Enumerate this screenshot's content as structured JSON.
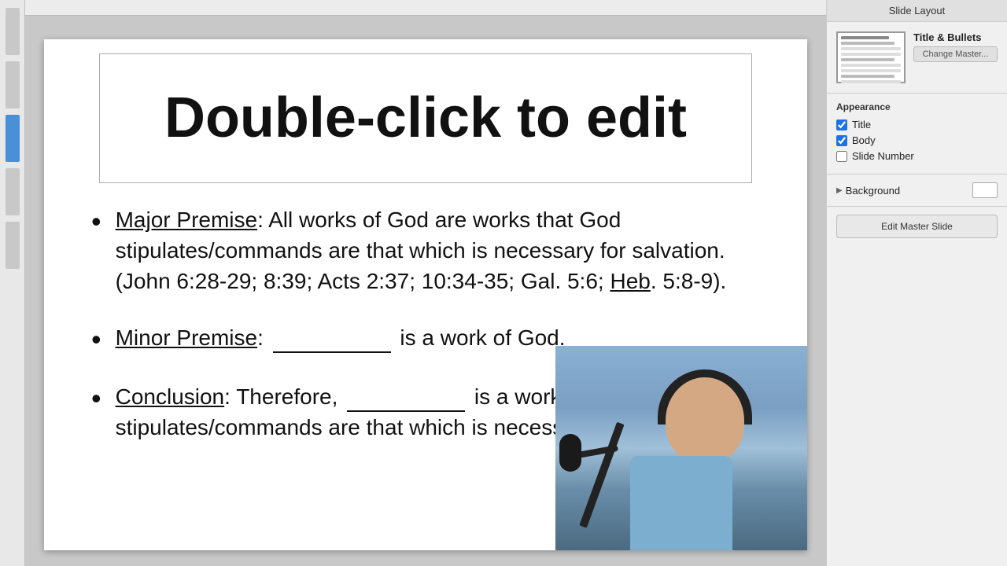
{
  "topBar": {},
  "leftSidebar": {
    "tabs": [
      {
        "id": "tab1",
        "active": false
      },
      {
        "id": "tab2",
        "active": false
      },
      {
        "id": "tab3",
        "active": true
      },
      {
        "id": "tab4",
        "active": false
      },
      {
        "id": "tab5",
        "active": false
      }
    ]
  },
  "slide": {
    "titlePlaceholder": "Double-click to edit",
    "bullets": [
      {
        "term": "Major Premise",
        "text": ": All works of God are works that God stipulates/commands are that which is necessary for salvation. (John 6:28-29; 8:39; Acts 2:37; 10:34-35; Gal. 5:6; Heb. 5:8-9)."
      },
      {
        "term": "Minor Premise",
        "text": ": ___________ is a work of God."
      },
      {
        "term": "Conclusion",
        "text": ": Therefore, ___________ is a work that God stipulates/commands are that which is necessary for salvation."
      }
    ]
  },
  "rightPanel": {
    "header": "Slide Layout",
    "layoutName": "Title & Bullets",
    "changeMasterBtn": "Change Master...",
    "appearance": {
      "title": "Appearance",
      "titleChecked": true,
      "bodyChecked": true,
      "slideNumberChecked": false,
      "titleLabel": "Title",
      "bodyLabel": "Body",
      "slideNumberLabel": "Slide Number"
    },
    "background": {
      "label": "Background"
    },
    "editMasterBtn": "Edit Master Slide"
  }
}
